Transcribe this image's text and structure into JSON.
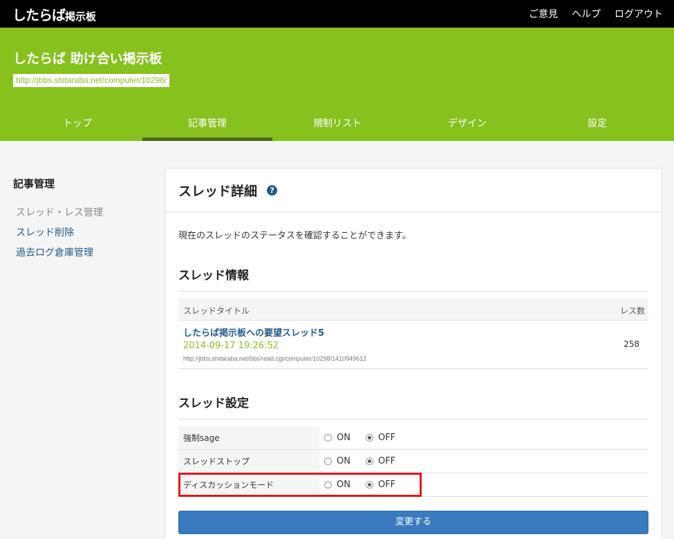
{
  "topbar": {
    "logo": "したらば",
    "logo_small": "掲示板",
    "links": [
      "ご意見",
      "ヘルプ",
      "ログアウト"
    ]
  },
  "header": {
    "board_title": "したらば 助け合い掲示板",
    "board_url": "http://jbbs.shitaraba.net/computer/10298/",
    "tabs": [
      "トップ",
      "記事管理",
      "規制リスト",
      "デザイン",
      "設定"
    ],
    "active_tab": "記事管理"
  },
  "sidebar": {
    "heading": "記事管理",
    "items": [
      "スレッド・レス管理",
      "スレッド削除",
      "過去ログ倉庫管理"
    ],
    "current": "スレッド・レス管理"
  },
  "panel": {
    "title": "スレッド詳細",
    "help_icon": "?",
    "description": "現在のスレッドのステータスを確認することができます。",
    "info_section": {
      "title": "スレッド情報",
      "col_title": "スレッドタイトル",
      "col_count": "レス数",
      "thread": {
        "name": "したらば掲示板への要望スレッド5",
        "date": "2014-09-17 19:26:52",
        "url": "http://jbbs.shitaraba.net/bbs/read.cgi/computer/10298/1410949612",
        "count": "258"
      }
    },
    "settings_section": {
      "title": "スレッド設定",
      "on_label": "ON",
      "off_label": "OFF",
      "rows": [
        {
          "label": "強制sage",
          "value": "OFF"
        },
        {
          "label": "スレッドストップ",
          "value": "OFF"
        },
        {
          "label": "ディスカッションモード",
          "value": "OFF"
        }
      ]
    },
    "submit_label": "変更する"
  },
  "colors": {
    "header_green": "#86c11e",
    "link_blue": "#1f5b8c",
    "button_blue": "#3a7abf",
    "highlight_red": "#e8141c"
  }
}
